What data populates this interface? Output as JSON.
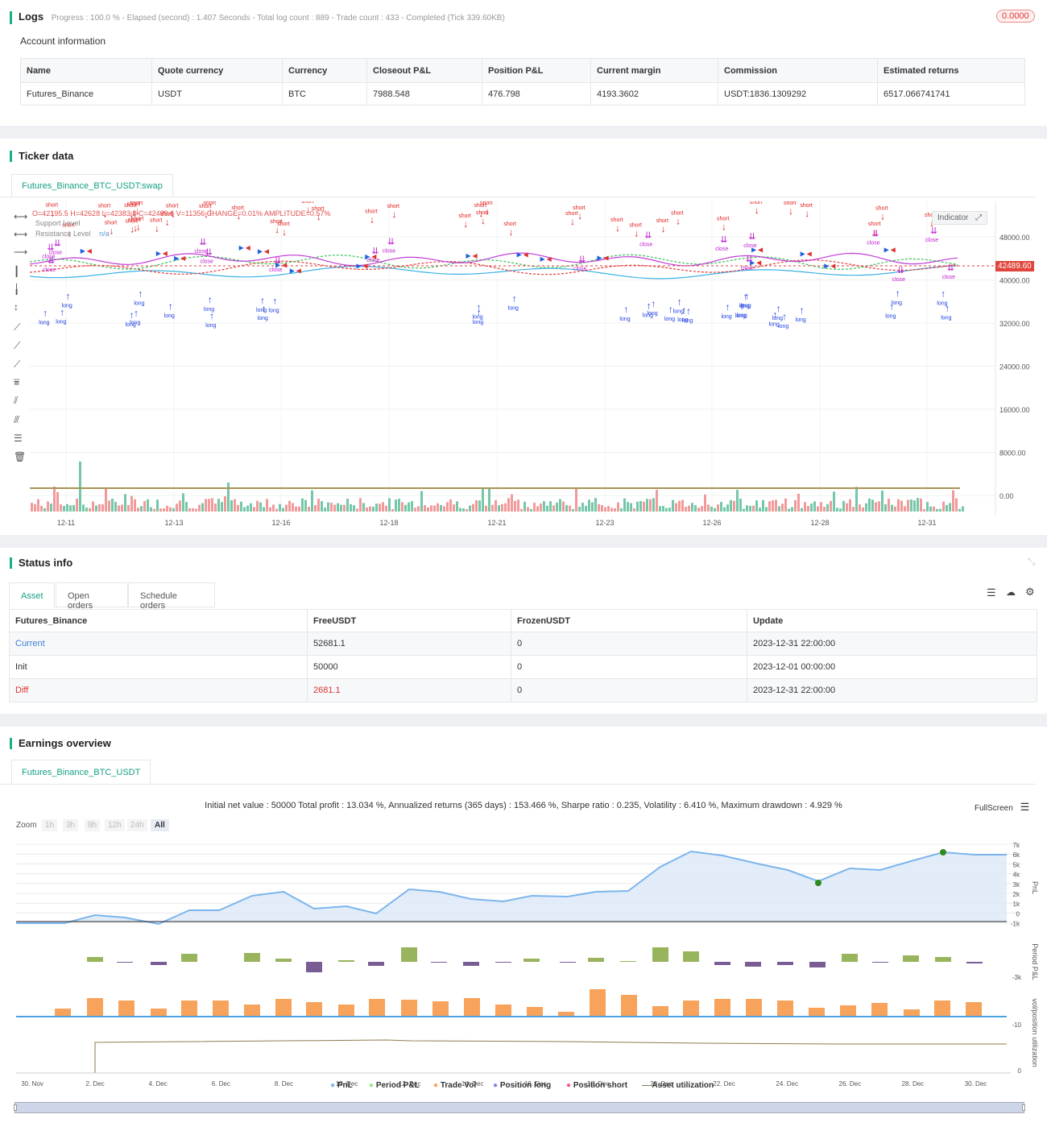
{
  "logs": {
    "title": "Logs",
    "progress": "Progress : 100.0 % - Elapsed (second) : 1.407  Seconds - Total log count : 889 - Trade count : 433 - Completed (Tick 339.60KB)",
    "badge": "0.0000",
    "account_title": "Account information",
    "columns": [
      "Name",
      "Quote currency",
      "Currency",
      "Closeout P&L",
      "Position P&L",
      "Current margin",
      "Commission",
      "Estimated returns"
    ],
    "row": [
      "Futures_Binance",
      "USDT",
      "BTC",
      "7988.548",
      "476.798",
      "4193.3602",
      "USDT:1836.1309292",
      "6517.066741741"
    ]
  },
  "ticker": {
    "title": "Ticker data",
    "tab": "Futures_Binance_BTC_USDT:swap",
    "ohlc": "O=42195.5 H=42628 L=42383.8 C=42489.6 V=11356 CHANGE=0.01% AMPLITUDE=0.57%",
    "legend": [
      "Support Level",
      "Resistance Level",
      "n/a"
    ],
    "indicator_label": "Indicator",
    "price_tag": "42489.60",
    "yaxis": [
      "48000.00",
      "40000.00",
      "32000.00",
      "24000.00",
      "16000.00",
      "8000.00",
      "0.00"
    ],
    "xaxis": [
      "12-11",
      "12-13",
      "12-16",
      "12-18",
      "12-21",
      "12-23",
      "12-26",
      "12-28",
      "12-31"
    ]
  },
  "status": {
    "title": "Status info",
    "tabs": [
      "Asset",
      "Open orders",
      "Schedule orders"
    ],
    "columns": [
      "Futures_Binance",
      "FreeUSDT",
      "FrozenUSDT",
      "Update"
    ],
    "rows": [
      [
        "Current",
        "52681.1",
        "0",
        "2023-12-31 22:00:00"
      ],
      [
        "Init",
        "50000",
        "0",
        "2023-12-01 00:00:00"
      ],
      [
        "Diff",
        "2681.1",
        "0",
        "2023-12-31 22:00:00"
      ]
    ]
  },
  "earnings": {
    "title": "Earnings overview",
    "tab": "Futures_Binance_BTC_USDT",
    "summary": "Initial net value : 50000  Total profit : 13.034 %, Annualized returns (365 days) : 153.466 %, Sharpe ratio : 0.235, Volatility : 6.410 %, Maximum drawdown : 4.929 %",
    "fullscreen": "FullScreen",
    "zoom_label": "Zoom",
    "zoom_options": [
      "1h",
      "3h",
      "8h",
      "12h",
      "24h",
      "All"
    ],
    "pnl_axis": [
      "7k",
      "6k",
      "5k",
      "4k",
      "3k",
      "2k",
      "1k",
      "0",
      "-1k"
    ],
    "axis_titles": [
      "PnL",
      "Period P&L",
      "vol/position",
      "utilization"
    ],
    "period_axis": "-3k",
    "vol_axis": "-10",
    "util_axis": "0",
    "xaxis": [
      "30. Nov",
      "2. Dec",
      "4. Dec",
      "6. Dec",
      "8. Dec",
      "10. Dec",
      "12. Dec",
      "14. Dec",
      "16. Dec",
      "18. Dec",
      "20. Dec",
      "22. Dec",
      "24. Dec",
      "26. Dec",
      "28. Dec",
      "30. Dec"
    ],
    "legend": [
      "PnL",
      "Period P&L",
      "Trade Vol",
      "Position long",
      "Position short",
      "Asset utilization"
    ],
    "legend_colors": [
      "#7cb5ec",
      "#90ed7d",
      "#f7a35c",
      "#8085e9",
      "#f15c80",
      "#8d7b4f"
    ]
  }
}
